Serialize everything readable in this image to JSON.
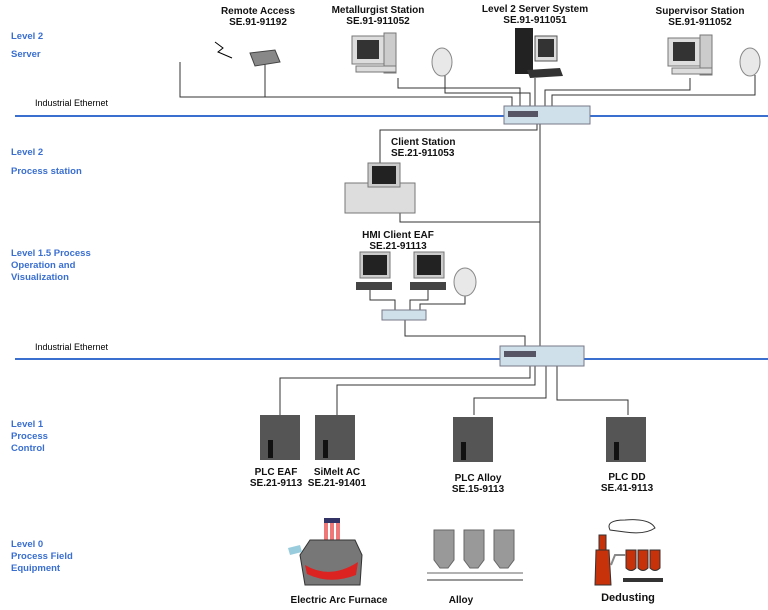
{
  "levels": {
    "l2_server": [
      "Level 2",
      "Server"
    ],
    "l2_process": [
      "Level 2",
      "Process station"
    ],
    "l15": [
      "Level 1.5  Process",
      "Operation and",
      "Visualization"
    ],
    "l1": [
      "Level 1",
      "Process",
      "Control"
    ],
    "l0": [
      "Level 0",
      "Process Field",
      "Equipment"
    ]
  },
  "networks": {
    "top": "Industrial Ethernet",
    "bottom": "Industrial Ethernet"
  },
  "nodes": {
    "remote": {
      "name": "Remote Access",
      "id": "SE.91-91192"
    },
    "metallurgist": {
      "name": "Metallurgist Station",
      "id": "SE.91-911052"
    },
    "server": {
      "name": "Level 2 Server System",
      "id": "SE.91-911051"
    },
    "supervisor": {
      "name": "Supervisor Station",
      "id": "SE.91-911052"
    },
    "client": {
      "name": "Client Station",
      "id": "SE.21-911053"
    },
    "hmi": {
      "name": "HMI Client EAF",
      "id": "SE.21-91113"
    },
    "plc_eaf": {
      "name": "PLC EAF",
      "id": "SE.21-9113"
    },
    "simelt": {
      "name": "SiMelt AC",
      "id": "SE.21-91401"
    },
    "plc_alloy": {
      "name": "PLC Alloy",
      "id": "SE.15-9113"
    },
    "plc_dd": {
      "name": "PLC DD",
      "id": "SE.41-9113"
    }
  },
  "equipment": {
    "eaf": "Electric Arc Furnace",
    "alloy": "Alloy",
    "dedusting": "Dedusting"
  },
  "colors": {
    "level_label": "#3a6fd0",
    "ethernet": "#3a6fd0",
    "equipment": "#c8320a"
  }
}
